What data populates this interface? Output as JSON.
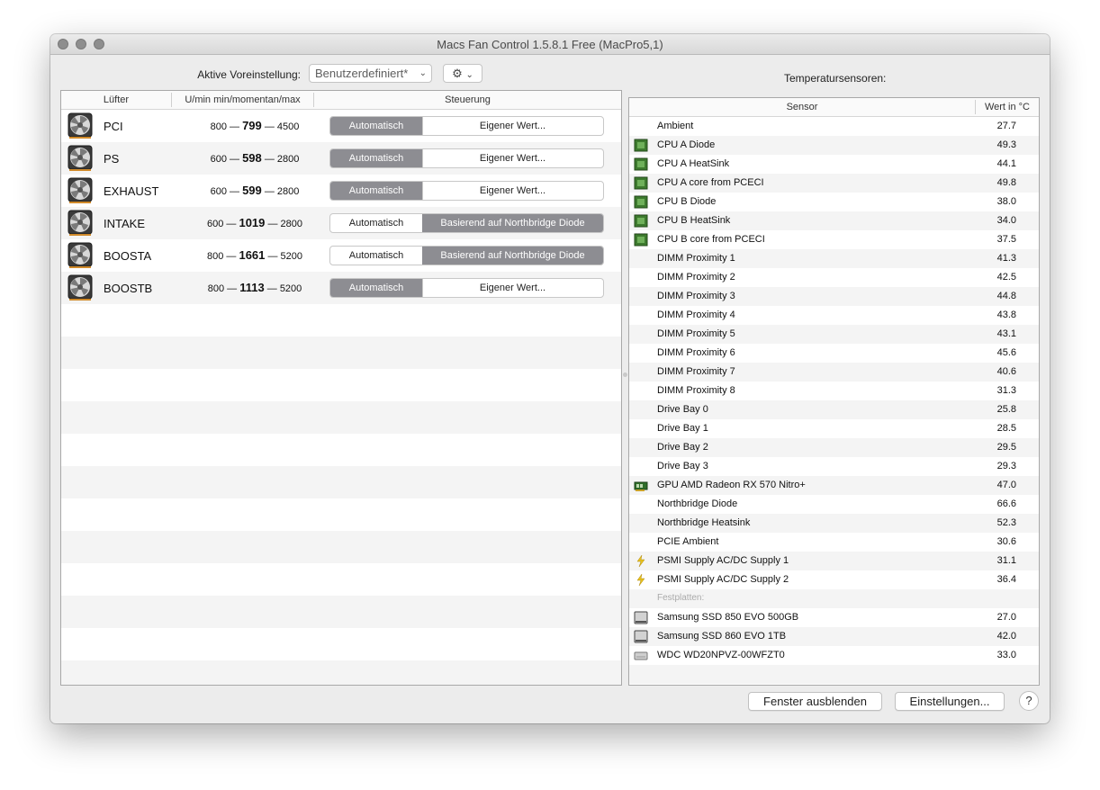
{
  "window": {
    "title": "Macs Fan Control 1.5.8.1 Free (MacPro5,1)"
  },
  "preset": {
    "label": "Aktive Voreinstellung:",
    "value": "Benutzerdefiniert*"
  },
  "temperature_title": "Temperatursensoren:",
  "fan_table": {
    "headers": {
      "fan": "Lüfter",
      "rpm": "U/min min/momentan/max",
      "control": "Steuerung"
    },
    "rows": [
      {
        "name": "PCI",
        "min": "800",
        "current": "799",
        "max": "4500",
        "mode_auto": "Automatisch",
        "mode_custom": "Eigener Wert...",
        "active": "auto"
      },
      {
        "name": "PS",
        "min": "600",
        "current": "598",
        "max": "2800",
        "mode_auto": "Automatisch",
        "mode_custom": "Eigener Wert...",
        "active": "auto"
      },
      {
        "name": "EXHAUST",
        "min": "600",
        "current": "599",
        "max": "2800",
        "mode_auto": "Automatisch",
        "mode_custom": "Eigener Wert...",
        "active": "auto"
      },
      {
        "name": "INTAKE",
        "min": "600",
        "current": "1019",
        "max": "2800",
        "mode_auto": "Automatisch",
        "mode_custom": "Basierend auf Northbridge Diode",
        "active": "custom"
      },
      {
        "name": "BOOSTA",
        "min": "800",
        "current": "1661",
        "max": "5200",
        "mode_auto": "Automatisch",
        "mode_custom": "Basierend auf Northbridge Diode",
        "active": "custom"
      },
      {
        "name": "BOOSTB",
        "min": "800",
        "current": "1113",
        "max": "5200",
        "mode_auto": "Automatisch",
        "mode_custom": "Eigener Wert...",
        "active": "auto"
      }
    ]
  },
  "sensor_table": {
    "headers": {
      "sensor": "Sensor",
      "value": "Wert in °C"
    },
    "rows": [
      {
        "name": "Ambient",
        "value": "27.7",
        "icon": "none"
      },
      {
        "name": "CPU A Diode",
        "value": "49.3",
        "icon": "cpu-chip-icon"
      },
      {
        "name": "CPU A HeatSink",
        "value": "44.1",
        "icon": "cpu-chip-icon"
      },
      {
        "name": "CPU A core from PCECI",
        "value": "49.8",
        "icon": "cpu-chip-icon"
      },
      {
        "name": "CPU B Diode",
        "value": "38.0",
        "icon": "cpu-chip-icon"
      },
      {
        "name": "CPU B HeatSink",
        "value": "34.0",
        "icon": "cpu-chip-icon"
      },
      {
        "name": "CPU B core from PCECI",
        "value": "37.5",
        "icon": "cpu-chip-icon"
      },
      {
        "name": "DIMM Proximity 1",
        "value": "41.3",
        "icon": "none"
      },
      {
        "name": "DIMM Proximity 2",
        "value": "42.5",
        "icon": "none"
      },
      {
        "name": "DIMM Proximity 3",
        "value": "44.8",
        "icon": "none"
      },
      {
        "name": "DIMM Proximity 4",
        "value": "43.8",
        "icon": "none"
      },
      {
        "name": "DIMM Proximity 5",
        "value": "43.1",
        "icon": "none"
      },
      {
        "name": "DIMM Proximity 6",
        "value": "45.6",
        "icon": "none"
      },
      {
        "name": "DIMM Proximity 7",
        "value": "40.6",
        "icon": "none"
      },
      {
        "name": "DIMM Proximity 8",
        "value": "31.3",
        "icon": "none"
      },
      {
        "name": "Drive Bay 0",
        "value": "25.8",
        "icon": "none"
      },
      {
        "name": "Drive Bay 1",
        "value": "28.5",
        "icon": "none"
      },
      {
        "name": "Drive Bay 2",
        "value": "29.5",
        "icon": "none"
      },
      {
        "name": "Drive Bay 3",
        "value": "29.3",
        "icon": "none"
      },
      {
        "name": "GPU AMD Radeon RX 570 Nitro+",
        "value": "47.0",
        "icon": "gpu-card-icon"
      },
      {
        "name": "Northbridge Diode",
        "value": "66.6",
        "icon": "none"
      },
      {
        "name": "Northbridge Heatsink",
        "value": "52.3",
        "icon": "none"
      },
      {
        "name": "PCIE Ambient",
        "value": "30.6",
        "icon": "none"
      },
      {
        "name": "PSMI Supply AC/DC Supply 1",
        "value": "31.1",
        "icon": "lightning-icon"
      },
      {
        "name": "PSMI Supply AC/DC Supply 2",
        "value": "36.4",
        "icon": "lightning-icon"
      },
      {
        "name": "Festplatten:",
        "value": "",
        "icon": "none",
        "section": true
      },
      {
        "name": "Samsung SSD 850 EVO 500GB",
        "value": "27.0",
        "icon": "ssd-icon"
      },
      {
        "name": "Samsung SSD 860 EVO 1TB",
        "value": "42.0",
        "icon": "ssd-icon"
      },
      {
        "name": "WDC WD20NPVZ-00WFZT0",
        "value": "33.0",
        "icon": "hard-drive-icon"
      }
    ]
  },
  "buttons": {
    "hide_window": "Fenster ausblenden",
    "settings": "Einstellungen...",
    "help": "?"
  },
  "colors": {
    "segment_active": "#8d8d92",
    "cpu_chip": "#3d7a2e",
    "lightning": "#e8c21c"
  }
}
